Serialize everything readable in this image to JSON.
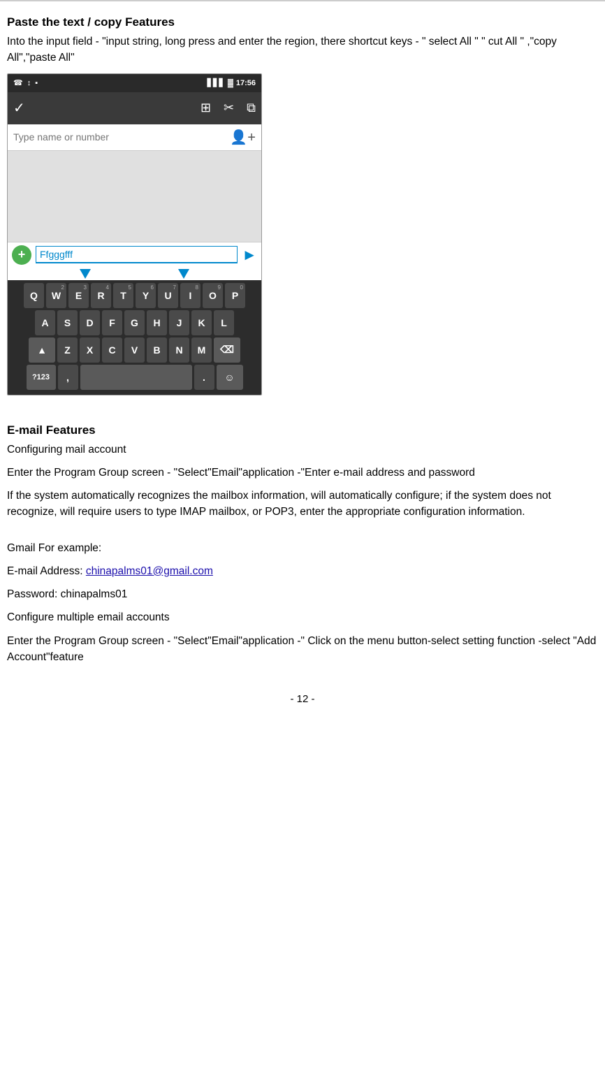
{
  "paste_section": {
    "title": "Paste the text / copy Features",
    "description": "Into the input field - \"input string, long press and enter the region, there shortcut keys - \" select All \" \" cut All \" ,\"copy All\",\"paste All\""
  },
  "phone_ui": {
    "status_bar": {
      "left_icons": [
        "☎",
        "↕",
        "▪"
      ],
      "signal": "▋▋▋",
      "battery": "🔋",
      "time": "17:56"
    },
    "action_bar": {
      "check_icon": "✓",
      "icons": [
        "⊞",
        "✂",
        "⧉"
      ]
    },
    "recipient_placeholder": "Type name or number",
    "sms_text": "Ffgggfff",
    "keyboard_rows": [
      [
        {
          "key": "Q",
          "num": ""
        },
        {
          "key": "W",
          "num": "2"
        },
        {
          "key": "E",
          "num": "3"
        },
        {
          "key": "R",
          "num": "4"
        },
        {
          "key": "T",
          "num": "5"
        },
        {
          "key": "Y",
          "num": "6"
        },
        {
          "key": "U",
          "num": "7"
        },
        {
          "key": "I",
          "num": "8"
        },
        {
          "key": "O",
          "num": "9"
        },
        {
          "key": "P",
          "num": "0"
        }
      ],
      [
        {
          "key": "A",
          "num": ""
        },
        {
          "key": "S",
          "num": ""
        },
        {
          "key": "D",
          "num": ""
        },
        {
          "key": "F",
          "num": ""
        },
        {
          "key": "G",
          "num": ""
        },
        {
          "key": "H",
          "num": ""
        },
        {
          "key": "J",
          "num": ""
        },
        {
          "key": "K",
          "num": ""
        },
        {
          "key": "L",
          "num": ""
        }
      ],
      [
        {
          "key": "Z",
          "num": ""
        },
        {
          "key": "X",
          "num": ""
        },
        {
          "key": "C",
          "num": ""
        },
        {
          "key": "V",
          "num": ""
        },
        {
          "key": "B",
          "num": ""
        },
        {
          "key": "N",
          "num": ""
        },
        {
          "key": "M",
          "num": ""
        }
      ],
      [
        {
          "key": "?123",
          "num": ""
        },
        {
          "key": ",",
          "num": ""
        },
        {
          "key": " ",
          "num": ""
        },
        {
          "key": ".",
          "num": ""
        },
        {
          "key": "☺",
          "num": ""
        }
      ]
    ]
  },
  "email_section": {
    "title": "E-mail Features",
    "configuring_label": "Configuring mail account",
    "enter_program": "Enter the Program Group screen - \"Select\"Email\"application -\"Enter e-mail address and password",
    "auto_config": "If the system automatically recognizes the mailbox information, will automatically configure; if the system does not recognize, will require users to type IMAP mailbox, or POP3, enter the appropriate configuration information.",
    "gmail_label": "Gmail For example:",
    "email_label": "E-mail Address:",
    "email_address": "chinapalms01@gmail.com",
    "password_label": "Password: chinapalms01",
    "configure_multiple": "Configure multiple email accounts",
    "enter_program2": "Enter the Program Group screen - \"Select\"Email\"application -\" Click on the menu button-select setting function -select \"Add Account\"feature"
  },
  "page_number": "- 12 -"
}
